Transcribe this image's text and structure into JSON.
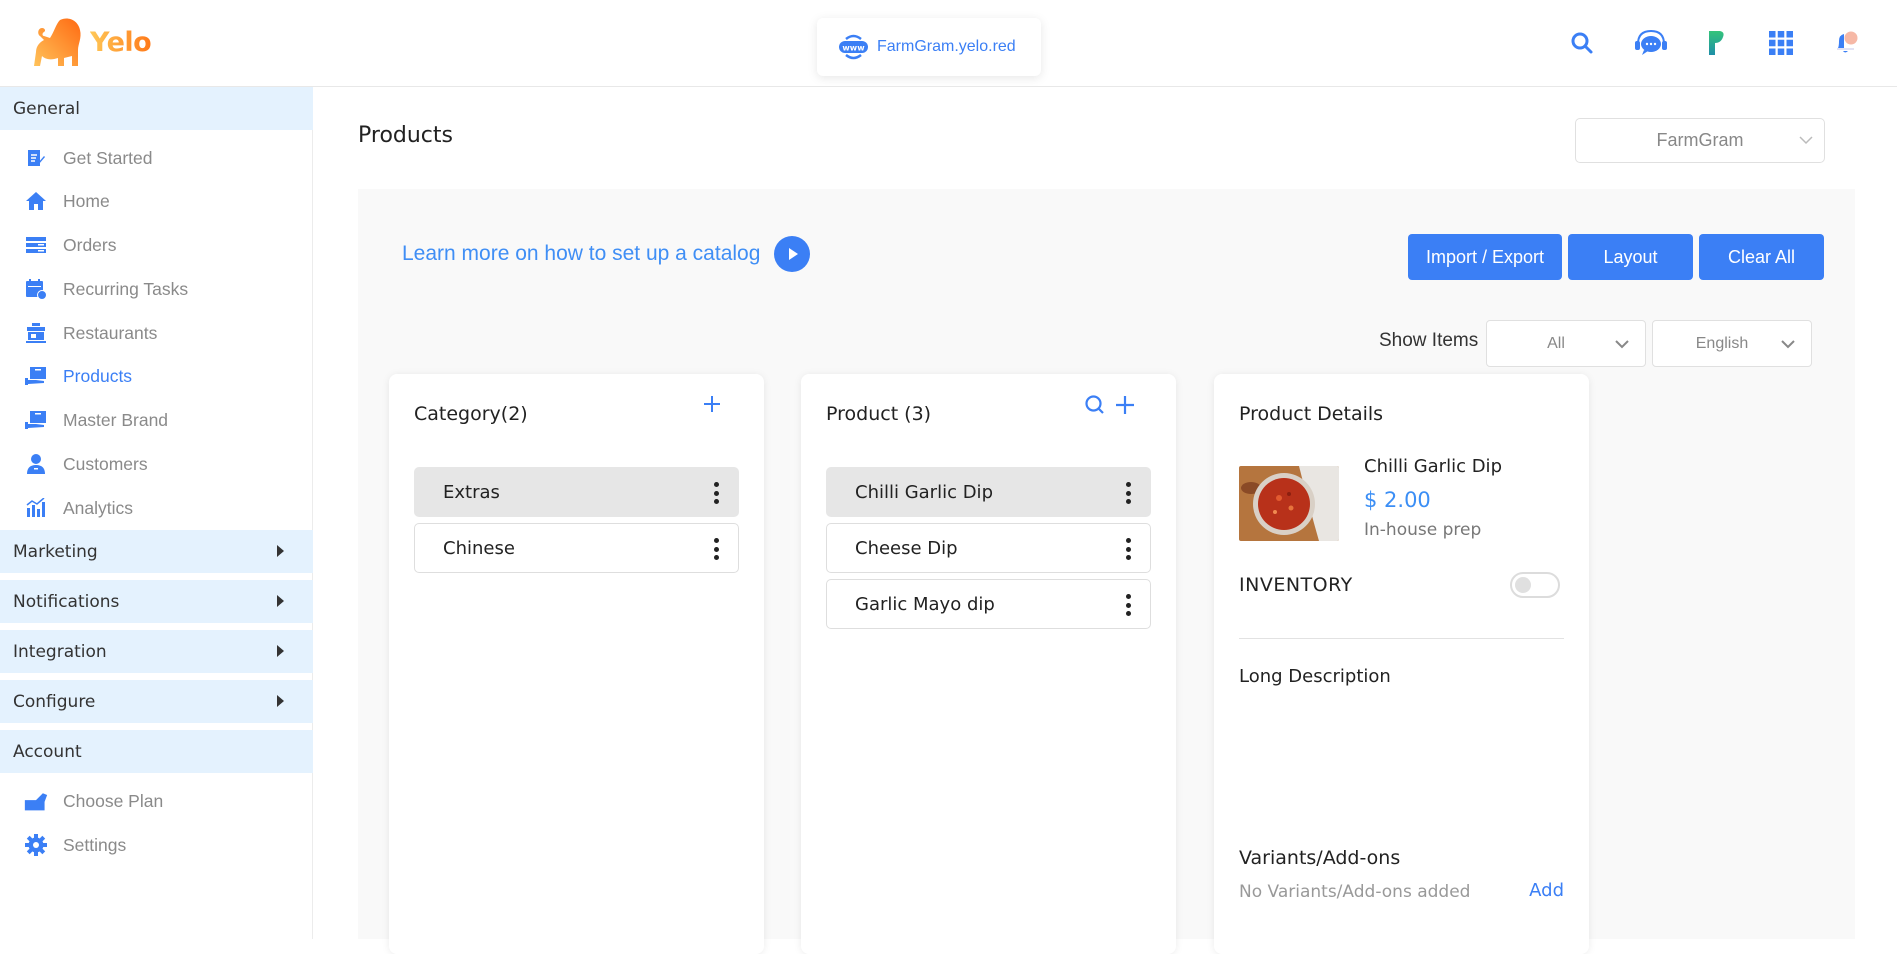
{
  "header": {
    "brand": "Yelo",
    "site_url": "FarmGram.yelo.red",
    "icons": [
      "search-icon",
      "support-chat-icon",
      "leaf-app-icon",
      "apps-grid-icon",
      "notifications-bell-icon"
    ]
  },
  "sidebar": {
    "sections": [
      {
        "label": "General",
        "collapsible": false,
        "items": [
          {
            "label": "Get Started",
            "icon": "clipboard-edit-icon"
          },
          {
            "label": "Home",
            "icon": "home-icon"
          },
          {
            "label": "Orders",
            "icon": "orders-list-icon"
          },
          {
            "label": "Recurring Tasks",
            "icon": "calendar-clock-icon"
          },
          {
            "label": "Restaurants",
            "icon": "storefront-icon"
          },
          {
            "label": "Products",
            "icon": "box-hand-icon",
            "active": true
          },
          {
            "label": "Master Brand",
            "icon": "box-hand-icon"
          },
          {
            "label": "Customers",
            "icon": "customer-icon"
          },
          {
            "label": "Analytics",
            "icon": "analytics-chart-icon"
          }
        ]
      },
      {
        "label": "Marketing",
        "collapsible": true
      },
      {
        "label": "Notifications",
        "collapsible": true
      },
      {
        "label": "Integration",
        "collapsible": true
      },
      {
        "label": "Configure",
        "collapsible": true
      },
      {
        "label": "Account",
        "collapsible": false,
        "items": [
          {
            "label": "Choose Plan",
            "icon": "plan-icon"
          },
          {
            "label": "Settings",
            "icon": "gear-icon"
          }
        ]
      }
    ]
  },
  "main": {
    "title": "Products",
    "store_select": {
      "value": "FarmGram"
    },
    "learn_link": "Learn more on how to set up a catalog",
    "buttons": {
      "import_export": "Import / Export",
      "layout": "Layout",
      "clear_all": "Clear All"
    },
    "show_items": {
      "label": "Show Items",
      "filter_value": "All",
      "language_value": "English"
    },
    "category_panel": {
      "title": "Category(2)",
      "items": [
        {
          "label": "Extras",
          "selected": true
        },
        {
          "label": "Chinese",
          "selected": false
        }
      ]
    },
    "product_panel": {
      "title": "Product (3)",
      "items": [
        {
          "label": "Chilli Garlic Dip",
          "selected": true
        },
        {
          "label": "Cheese Dip",
          "selected": false
        },
        {
          "label": "Garlic Mayo dip",
          "selected": false
        }
      ]
    },
    "details_panel": {
      "title": "Product Details",
      "product_name": "Chilli Garlic Dip",
      "price": "$ 2.00",
      "source": "In-house prep",
      "inventory_label": "INVENTORY",
      "inventory_enabled": false,
      "long_description_label": "Long Description",
      "variants_label": "Variants/Add-ons",
      "no_variants_text": "No Variants/Add-ons added",
      "add_label": "Add"
    }
  },
  "colors": {
    "accent": "#3b7ff5",
    "sidebar_section_bg": "#e4f2fe",
    "workspace_bg": "#f9f9f9",
    "brand_orange": "#ff7a1a"
  }
}
